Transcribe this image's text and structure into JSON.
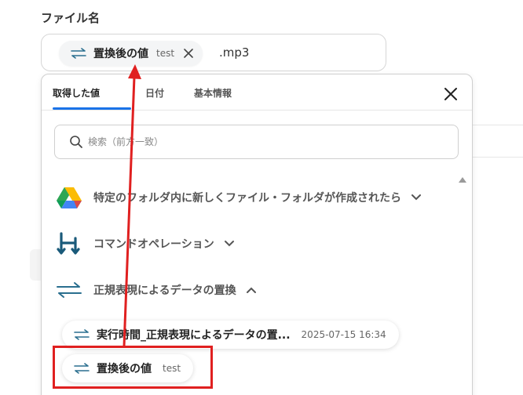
{
  "field": {
    "label": "ファイル名",
    "chip_name": "置換後の値",
    "chip_value": "test",
    "extension": ".mp3"
  },
  "panel": {
    "tabs": [
      {
        "label": "取得した値",
        "active": true
      },
      {
        "label": "日付",
        "active": false
      },
      {
        "label": "基本情報",
        "active": false
      }
    ],
    "search": {
      "placeholder": "検索（前方一致）"
    },
    "sections": [
      {
        "label": "特定のフォルダ内に新しくファイル・フォルダが作成されたら",
        "icon": "google-drive-icon",
        "expanded": false
      },
      {
        "label": "コマンドオペレーション",
        "icon": "command-operation-icon",
        "expanded": false
      },
      {
        "label": "正規表現によるデータの置換",
        "icon": "replace-arrows-icon",
        "expanded": true
      }
    ],
    "items": [
      {
        "name": "実行時間_正規表現によるデータの置...",
        "value": "2025-07-15 16:34"
      },
      {
        "name": "置換後の値",
        "value": "test"
      }
    ]
  },
  "colors": {
    "accent": "#1a73e8",
    "highlight": "#e02020",
    "replace_icon": "#2a6f8f"
  }
}
